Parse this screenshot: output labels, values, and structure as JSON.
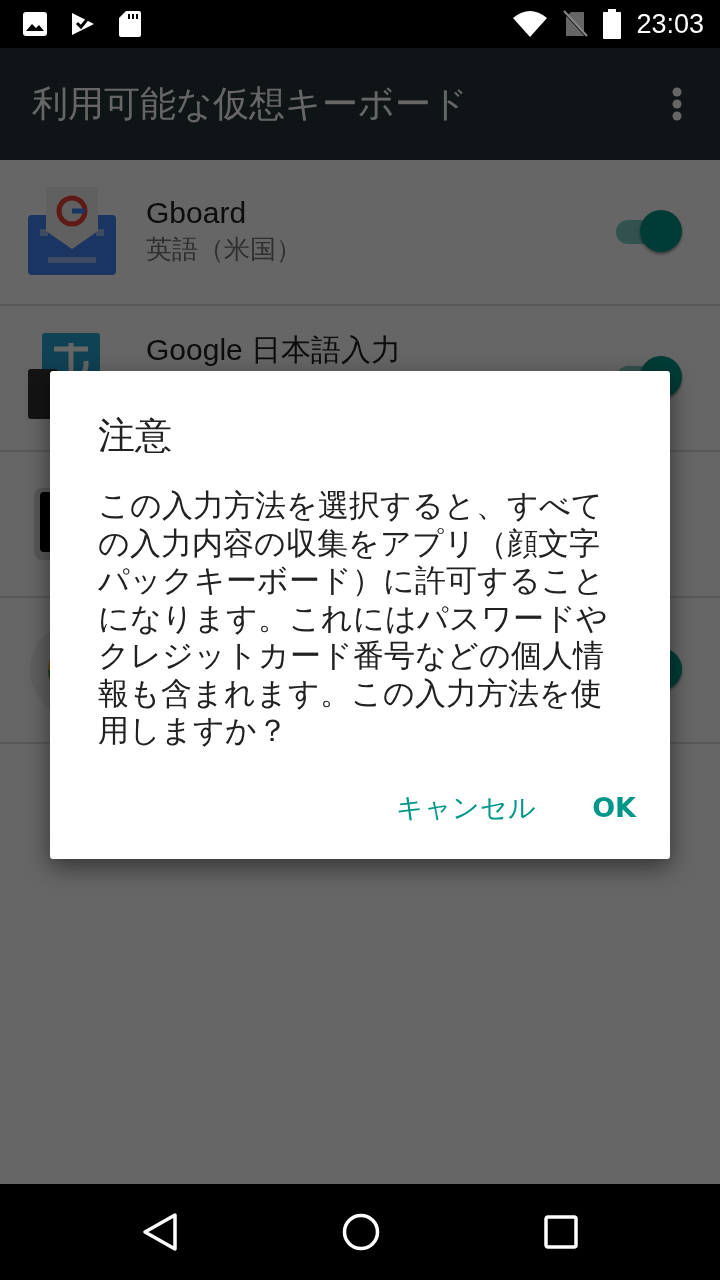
{
  "status_bar": {
    "time": "23:03"
  },
  "app_bar": {
    "title": "利用可能な仮想キーボード"
  },
  "keyboards": [
    {
      "kind": "gboard",
      "title": "Gboard",
      "subtitle": "英語（米国）",
      "on": true
    },
    {
      "kind": "kana",
      "title": "Google 日本語入力",
      "on": true
    },
    {
      "kind": "phone"
    },
    {
      "kind": "round",
      "on": true
    }
  ],
  "dialog": {
    "title": "注意",
    "message": "この入力方法を選択すると、すべての入力内容の収集をアプリ（顔文字パックキーボード）に許可することになります。これにはパスワードやクレジットカード番号などの個人情報も含まれます。この入力方法を使用しますか？",
    "buttons": [
      "キャンセル",
      "OK"
    ]
  }
}
